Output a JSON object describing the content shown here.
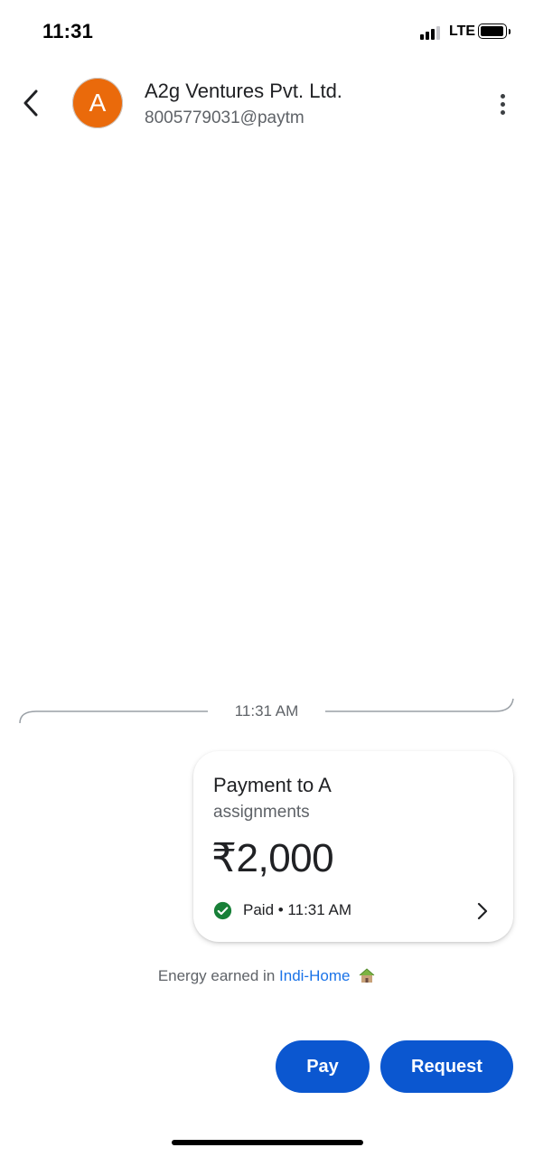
{
  "status_bar": {
    "time": "11:31",
    "network": "LTE",
    "signal_bars": 3,
    "battery_icon": "battery-icon"
  },
  "header": {
    "avatar_letter": "A",
    "avatar_color": "#ea6a0b",
    "contact_name": "A2g Ventures Pvt. Ltd.",
    "contact_upi": "8005779031@paytm",
    "back_icon": "back-arrow-icon",
    "more_icon": "more-vert-icon"
  },
  "timeline": {
    "divider_time": "11:31 AM"
  },
  "payment_card": {
    "title": "Payment to A",
    "note": "assignments",
    "amount": "₹2,000",
    "status": "Paid • 11:31 AM",
    "status_icon": "check-circle-icon",
    "status_color": "#188038",
    "chevron_icon": "chevron-right-icon"
  },
  "energy": {
    "prefix": "Energy earned in ",
    "link": "Indi-Home",
    "icon": "house-icon"
  },
  "actions": {
    "pay_label": "Pay",
    "request_label": "Request",
    "button_color": "#0b57d0"
  }
}
